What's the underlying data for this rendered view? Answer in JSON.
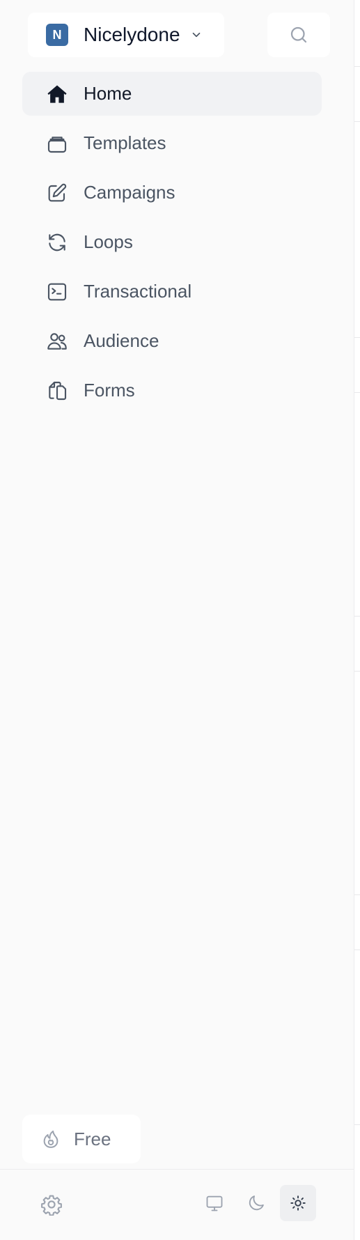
{
  "workspace": {
    "initial": "N",
    "name": "Nicelydone",
    "avatar_color": "#3a6ba3",
    "chevron_icon": "chevron-down-icon"
  },
  "search": {
    "icon": "search-icon"
  },
  "nav": {
    "items": [
      {
        "label": "Home",
        "icon": "home-icon",
        "active": true
      },
      {
        "label": "Templates",
        "icon": "templates-icon",
        "active": false
      },
      {
        "label": "Campaigns",
        "icon": "pencil-square-icon",
        "active": false
      },
      {
        "label": "Loops",
        "icon": "refresh-icon",
        "active": false
      },
      {
        "label": "Transactional",
        "icon": "terminal-icon",
        "active": false
      },
      {
        "label": "Audience",
        "icon": "users-icon",
        "active": false
      },
      {
        "label": "Forms",
        "icon": "documents-icon",
        "active": false
      }
    ]
  },
  "plan": {
    "label": "Free",
    "icon": "flame-icon"
  },
  "footer": {
    "settings_icon": "gear-icon",
    "theme_options": [
      {
        "icon": "monitor-icon",
        "active": false
      },
      {
        "icon": "moon-icon",
        "active": false
      },
      {
        "icon": "sun-icon",
        "active": true
      }
    ]
  },
  "colors": {
    "sidebar_bg": "#fafafa",
    "active_bg": "#f1f2f4",
    "text_primary": "#111827",
    "text_secondary": "#4b5563"
  }
}
